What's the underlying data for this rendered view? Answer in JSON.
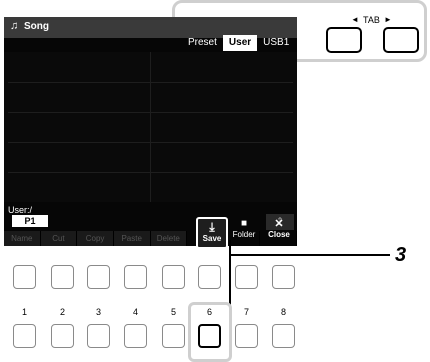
{
  "screen": {
    "note_icon": "♫",
    "title": "Song",
    "tabs": [
      {
        "label": "Preset",
        "active": false
      },
      {
        "label": "User",
        "active": true
      },
      {
        "label": "USB1",
        "active": false
      }
    ],
    "path_label": "User:/",
    "page_indicator": "P1",
    "up_icon": "up-arrow-icon",
    "commands": [
      {
        "label": "Name",
        "icon": "cursor-icon",
        "enabled": false
      },
      {
        "label": "Cut",
        "icon": "scissors-icon",
        "enabled": false
      },
      {
        "label": "Copy",
        "icon": "copy-icon",
        "enabled": false
      },
      {
        "label": "Paste",
        "icon": "paste-icon",
        "enabled": false
      },
      {
        "label": "Delete",
        "icon": "trash-icon",
        "enabled": false
      },
      {
        "label": "Save",
        "icon": "download-icon",
        "enabled": true
      },
      {
        "label": "Folder",
        "icon": "folder-icon",
        "enabled": true
      },
      {
        "label": "Close",
        "icon": "close-icon",
        "enabled": true
      }
    ]
  },
  "tab_control": {
    "label": "TAB",
    "left_arrow": "◄",
    "right_arrow": "►"
  },
  "panel": {
    "button_numbers": [
      "1",
      "2",
      "3",
      "4",
      "5",
      "6",
      "7",
      "8"
    ]
  },
  "callout": {
    "step": "3"
  },
  "colors": {
    "screen_bg": "#060606",
    "highlight_border": "#cfcfcf"
  }
}
